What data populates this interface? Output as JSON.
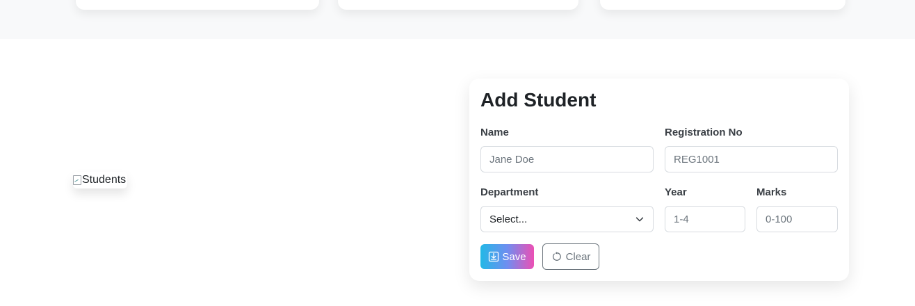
{
  "students_image": {
    "alt": "Students"
  },
  "form": {
    "title": "Add Student",
    "name": {
      "label": "Name",
      "placeholder": "Jane Doe",
      "value": ""
    },
    "registration": {
      "label": "Registration No",
      "placeholder": "REG1001",
      "value": ""
    },
    "department": {
      "label": "Department",
      "selected": "Select..."
    },
    "year": {
      "label": "Year",
      "placeholder": "1-4",
      "value": ""
    },
    "marks": {
      "label": "Marks",
      "placeholder": "0-100",
      "value": ""
    },
    "save_label": "Save",
    "clear_label": "Clear"
  },
  "colors": {
    "save_gradient_start": "#22b8e6",
    "save_gradient_end": "#ec4fb4",
    "clear_border": "#6c757d",
    "page_band": "#f8f9fa"
  },
  "icons": {
    "save": "download-box-icon",
    "clear": "rotate-ccw-icon",
    "department": "chevron-down-icon",
    "image": "broken-image-icon"
  }
}
